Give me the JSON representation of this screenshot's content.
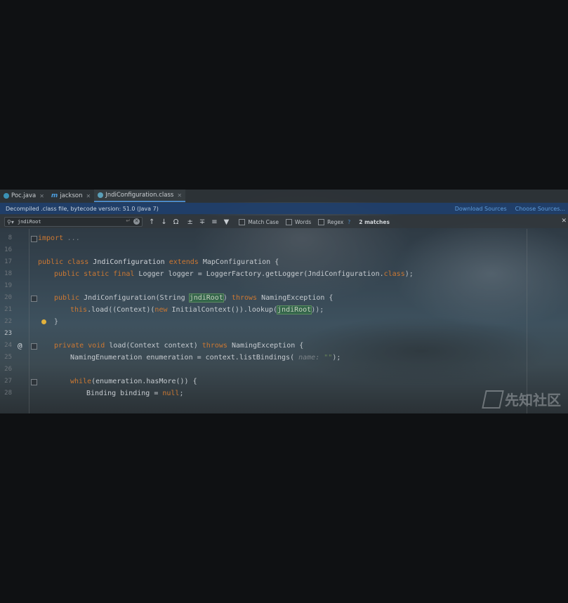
{
  "tabs": [
    {
      "label": "Poc.java",
      "icon": "class-icon",
      "active": false
    },
    {
      "label": "jackson",
      "icon": "module-icon",
      "active": false
    },
    {
      "label": "JndiConfiguration.class",
      "icon": "class-file-icon",
      "active": true
    }
  ],
  "notice": {
    "message": "Decompiled .class file, bytecode version: 51.0 (Java 7)",
    "download_sources": "Download Sources",
    "choose_sources": "Choose Sources..."
  },
  "find": {
    "query": "jndiRoot",
    "match_case": "Match Case",
    "words": "Words",
    "regex": "Regex",
    "help": "?",
    "matches": "2 matches"
  },
  "code": {
    "line_numbers": [
      "8",
      "16",
      "17",
      "18",
      "19",
      "20",
      "21",
      "22",
      "23",
      "24",
      "25",
      "26",
      "27",
      "28"
    ],
    "l_import": "import",
    "l_import_dots": "...",
    "l_public": "public",
    "l_class": "class",
    "l_classname": "JndiConfiguration",
    "l_extends": "extends",
    "l_superclass": "MapConfiguration {",
    "l_static": "public static final",
    "l_logger": "Logger logger = LoggerFactory.getLogger(JndiConfiguration.",
    "l_classkw": "class",
    "l_logger_end": ");",
    "l_ctor": "JndiConfiguration(String",
    "l_param_hl": "jndiRoot",
    "l_ctor_close": ")",
    "l_throws": "throws",
    "l_ctor_exc": "NamingException {",
    "l_this": "this",
    "l_load": ".load((Context)(",
    "l_new": "new",
    "l_lookup": "InitialContext()).lookup(",
    "l_arg_hl": "jndiRoot",
    "l_lookup_end": "));",
    "l_brace": "}",
    "l_private": "private",
    "l_void": "void",
    "l_load_sig": "load(Context context)",
    "l_load_exc": "NamingException {",
    "l_enum": "NamingEnumeration enumeration = context.listBindings(",
    "l_hint_name": "name:",
    "l_hint_str": "\"\"",
    "l_enum_end": ");",
    "l_while": "while",
    "l_while_cond": "(enumeration.hasMore()) {",
    "l_binding": "Binding binding = ",
    "l_null": "null",
    "l_semicolon": ";"
  },
  "watermark": "先知社区"
}
